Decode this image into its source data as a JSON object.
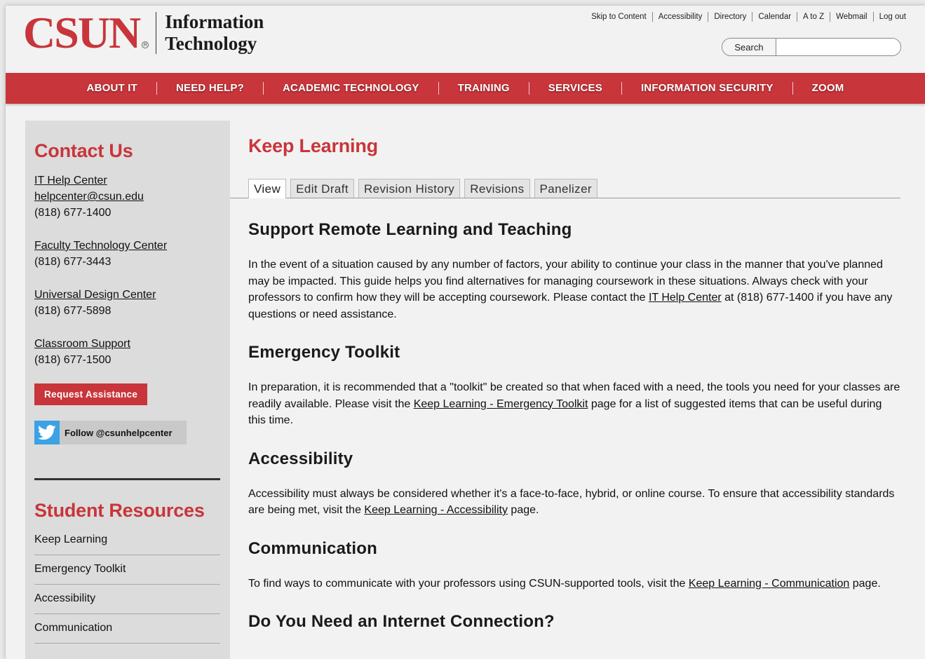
{
  "logo": {
    "brand": "CSUN",
    "registered": "R",
    "sub_line1": "Information",
    "sub_line2": "Technology"
  },
  "utility_links": [
    "Skip to Content",
    "Accessibility",
    "Directory",
    "Calendar",
    "A to Z",
    "Webmail",
    "Log out"
  ],
  "search": {
    "button_label": "Search",
    "placeholder": ""
  },
  "nav": [
    "ABOUT IT",
    "NEED HELP?",
    "ACADEMIC TECHNOLOGY",
    "TRAINING",
    "SERVICES",
    "INFORMATION SECURITY",
    "ZOOM"
  ],
  "sidebar": {
    "contact_heading": "Contact Us",
    "contacts": [
      {
        "name": "IT Help Center",
        "email": "helpcenter@csun.edu",
        "phone": "(818) 677-1400"
      },
      {
        "name": "Faculty Technology Center",
        "phone": "(818) 677-3443"
      },
      {
        "name": "Universal Design Center",
        "phone": "(818) 677-5898"
      },
      {
        "name": "Classroom Support",
        "phone": "(818) 677-1500"
      }
    ],
    "request_button": "Request Assistance",
    "twitter_label": "Follow @csunhelpcenter",
    "resources_heading": "Student Resources",
    "resources": [
      "Keep Learning",
      "Emergency Toolkit",
      "Accessibility",
      "Communication"
    ]
  },
  "main": {
    "title": "Keep Learning",
    "tabs": [
      "View",
      "Edit Draft",
      "Revision History",
      "Revisions",
      "Panelizer"
    ],
    "sections": [
      {
        "heading": "Support Remote Learning and Teaching",
        "p1": "In the event of a situation caused by any number of factors, your ability to continue your class in the manner that you've planned may be impacted. This guide helps you find alternatives for managing coursework in these situations. Always check with your professors to confirm how they will be accepting coursework. Please contact the ",
        "link": "IT Help Center",
        "p2": " at (818) 677-1400 if you have any questions or need assistance."
      },
      {
        "heading": "Emergency Toolkit",
        "p1": "In preparation, it is recommended that a \"toolkit\" be created so that when faced with a need, the tools you need for your classes are readily available. Please visit the ",
        "link": "Keep Learning - Emergency Toolkit",
        "p2": " page for a list of suggested items that can be useful during this time."
      },
      {
        "heading": "Accessibility",
        "p1": "Accessibility must always be considered whether it's a face-to-face, hybrid, or online course. To ensure that accessibility standards are being met, visit the ",
        "link": "Keep Learning - Accessibility",
        "p2": " page."
      },
      {
        "heading": "Communication",
        "p1": "To find ways to communicate with your professors using CSUN-supported tools, visit the ",
        "link": "Keep Learning - Communication",
        "p2": " page."
      },
      {
        "heading": "Do You Need an Internet Connection?"
      }
    ]
  },
  "colors": {
    "brand_red": "#c8353a",
    "twitter_blue": "#3aa2e5",
    "sidebar_bg": "#dcdcdc"
  }
}
